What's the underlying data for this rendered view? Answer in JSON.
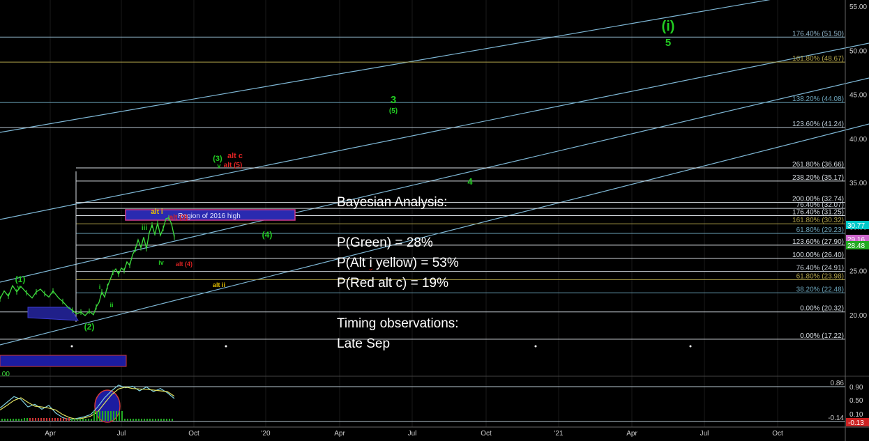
{
  "chart_data": {
    "type": "line",
    "x_ticks": [
      "Apr",
      "Jul",
      "Oct",
      "'20",
      "Apr",
      "Jul",
      "Oct",
      "'21",
      "Apr",
      "Jul",
      "Oct"
    ],
    "y_ticks": [
      "55.00",
      "50.00",
      "45.00",
      "40.00",
      "35.00",
      "30.00",
      "25.00",
      "20.00"
    ],
    "ylim": [
      17.2,
      55.4
    ],
    "fib_levels": [
      {
        "label": "176.40% (51.50)",
        "price": 51.5,
        "color": "#8fb4c8"
      },
      {
        "label": "161.80% (48.67)",
        "price": 48.67,
        "color": "#b0a24a"
      },
      {
        "label": "138.20% (44.08)",
        "price": 44.08,
        "color": "#6aa2b8"
      },
      {
        "label": "123.60% (41.24)",
        "price": 41.24,
        "color": "#b8c7d2"
      },
      {
        "label": "261.80% (36.66)",
        "price": 36.66,
        "color": "#d8dee3"
      },
      {
        "label": "238.20% (35.17)",
        "price": 35.17,
        "color": "#d8dee3"
      },
      {
        "label": "200.00% (32.74)",
        "price": 32.74,
        "color": "#d8dee3"
      },
      {
        "label": "76.40% (32.07)",
        "price": 32.07,
        "color": "#c9d1d8"
      },
      {
        "label": "176.40% (31.25)",
        "price": 31.25,
        "color": "#d8dee3"
      },
      {
        "label": "161.80% (30.32)",
        "price": 30.32,
        "color": "#b0a24a"
      },
      {
        "label": "61.80% (29.23)",
        "price": 29.23,
        "color": "#6aa2b8"
      },
      {
        "label": "123.60% (27.90)",
        "price": 27.9,
        "color": "#d8dee3"
      },
      {
        "label": "100.00% (26.40)",
        "price": 26.4,
        "color": "#d8dee3"
      },
      {
        "label": "76.40% (24.91)",
        "price": 24.91,
        "color": "#c9d1d8"
      },
      {
        "label": "61.80% (23.98)",
        "price": 23.98,
        "color": "#b0a24a"
      },
      {
        "label": "38.20% (22.48)",
        "price": 22.48,
        "color": "#6aa2b8"
      },
      {
        "label": "0.00% (20.32)",
        "price": 20.32,
        "color": "#c9d1d8"
      },
      {
        "label": "0.00% (17.22)",
        "price": 17.22,
        "color": "#d8dee3"
      }
    ],
    "price_tags": [
      {
        "label": "30.77",
        "color": "#00c9c9"
      },
      {
        "label": "29.16",
        "color": "#cc66cc"
      },
      {
        "label": "28.48",
        "color": "#22aa22"
      }
    ],
    "indicator": {
      "y_ticks": [
        "0.90",
        "0.50",
        "0.10"
      ],
      "levels": [
        "0.86",
        "-0.14"
      ],
      "tag": "-0.13",
      "left_value": ".00"
    },
    "wave_labels": [
      {
        "text": "(i)",
        "color": "#22cc22"
      },
      {
        "text": "5",
        "color": "#22cc22"
      },
      {
        "text": "3",
        "color": "#22cc22"
      },
      {
        "text": "(5)",
        "color": "#22cc22"
      },
      {
        "text": "4",
        "color": "#22cc22"
      },
      {
        "text": "(4)",
        "color": "#22cc22"
      },
      {
        "text": "(3)",
        "color": "#22cc22"
      },
      {
        "text": "v",
        "color": "#22cc22"
      },
      {
        "text": "alt c",
        "color": "#dd2222"
      },
      {
        "text": "alt (5)",
        "color": "#dd2222"
      },
      {
        "text": "alt i",
        "color": "#e5c100"
      },
      {
        "text": "alt (3)",
        "color": "#dd2222"
      },
      {
        "text": "iii",
        "color": "#22cc22"
      },
      {
        "text": "iv",
        "color": "#22cc22"
      },
      {
        "text": "alt (4)",
        "color": "#dd2222"
      },
      {
        "text": "alt ii",
        "color": "#e5c100"
      },
      {
        "text": "(1)",
        "color": "#22cc22"
      },
      {
        "text": "v",
        "color": "#22cc22"
      },
      {
        "text": "i",
        "color": "#22cc22"
      },
      {
        "text": "ii",
        "color": "#22cc22"
      },
      {
        "text": "(2)",
        "color": "#22cc22"
      }
    ],
    "region_label": "Region of 2016 high",
    "price": [
      [
        0,
        21.8
      ],
      [
        6,
        22.7
      ],
      [
        12,
        22.1
      ],
      [
        18,
        23.3
      ],
      [
        24,
        22.6
      ],
      [
        30,
        23.2
      ],
      [
        38,
        22.5
      ],
      [
        46,
        21.9
      ],
      [
        52,
        22.6
      ],
      [
        58,
        22.9
      ],
      [
        64,
        22.4
      ],
      [
        70,
        22.0
      ],
      [
        76,
        22.7
      ],
      [
        84,
        21.9
      ],
      [
        90,
        21.5
      ],
      [
        98,
        20.8
      ],
      [
        104,
        20.5
      ],
      [
        110,
        20.1
      ],
      [
        116,
        20.3
      ],
      [
        122,
        19.9
      ],
      [
        128,
        20.4
      ],
      [
        134,
        20.0
      ],
      [
        138,
        20.9
      ],
      [
        142,
        21.4
      ],
      [
        146,
        22.6
      ],
      [
        150,
        22.0
      ],
      [
        154,
        23.2
      ],
      [
        158,
        24.0
      ],
      [
        162,
        24.8
      ],
      [
        166,
        25.2
      ],
      [
        170,
        24.6
      ],
      [
        174,
        25.3
      ],
      [
        178,
        25.0
      ],
      [
        182,
        26.0
      ],
      [
        186,
        25.6
      ],
      [
        190,
        26.8
      ],
      [
        194,
        27.4
      ],
      [
        198,
        28.5
      ],
      [
        202,
        27.6
      ],
      [
        206,
        28.8
      ],
      [
        210,
        27.5
      ],
      [
        214,
        29.3
      ],
      [
        218,
        30.2
      ],
      [
        222,
        29.1
      ],
      [
        226,
        30.4
      ],
      [
        230,
        29.0
      ],
      [
        234,
        29.8
      ],
      [
        238,
        30.9
      ],
      [
        242,
        31.0
      ],
      [
        246,
        30.3
      ],
      [
        250,
        28.8
      ]
    ],
    "osc_a": [
      [
        0,
        0.35
      ],
      [
        10,
        0.5
      ],
      [
        20,
        0.65
      ],
      [
        30,
        0.58
      ],
      [
        40,
        0.38
      ],
      [
        50,
        0.45
      ],
      [
        60,
        0.32
      ],
      [
        70,
        0.42
      ],
      [
        80,
        0.22
      ],
      [
        90,
        0.1
      ],
      [
        100,
        0.05
      ],
      [
        110,
        0.08
      ],
      [
        120,
        0.12
      ],
      [
        130,
        0.18
      ],
      [
        140,
        0.38
      ],
      [
        150,
        0.62
      ],
      [
        160,
        0.8
      ],
      [
        170,
        0.95
      ],
      [
        180,
        0.88
      ],
      [
        190,
        0.92
      ],
      [
        200,
        0.8
      ],
      [
        210,
        0.9
      ],
      [
        220,
        0.78
      ],
      [
        230,
        0.86
      ],
      [
        240,
        0.75
      ],
      [
        250,
        0.6
      ]
    ],
    "osc_b": [
      [
        0,
        0.3
      ],
      [
        10,
        0.42
      ],
      [
        20,
        0.55
      ],
      [
        30,
        0.62
      ],
      [
        40,
        0.5
      ],
      [
        50,
        0.4
      ],
      [
        60,
        0.38
      ],
      [
        70,
        0.35
      ],
      [
        80,
        0.3
      ],
      [
        90,
        0.18
      ],
      [
        100,
        0.1
      ],
      [
        110,
        0.06
      ],
      [
        120,
        0.09
      ],
      [
        130,
        0.14
      ],
      [
        140,
        0.25
      ],
      [
        150,
        0.48
      ],
      [
        160,
        0.7
      ],
      [
        170,
        0.85
      ],
      [
        180,
        0.9
      ],
      [
        190,
        0.86
      ],
      [
        200,
        0.85
      ],
      [
        210,
        0.84
      ],
      [
        220,
        0.82
      ],
      [
        230,
        0.8
      ],
      [
        240,
        0.78
      ],
      [
        250,
        0.66
      ]
    ]
  },
  "annotation": {
    "title": "Bayesian Analysis:",
    "p_green": "P(Green) = 28%",
    "p_alt_prefix": "P(Alt ",
    "p_alt_word": "i",
    "p_alt_suffix": " yellow) = 53%",
    "p_red": "P(Red alt c) = 19%",
    "timing_title": "Timing observations:",
    "timing_value": "Late Sep"
  }
}
